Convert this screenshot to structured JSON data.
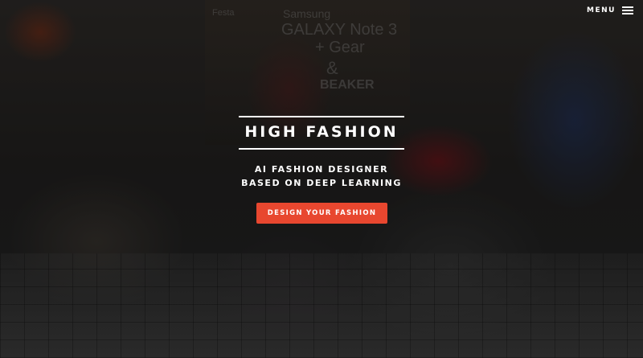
{
  "background": {
    "signs": {
      "festa": "Festa",
      "samsung": "Samsung",
      "galaxy": "GALAXY Note 3",
      "gear": "+ Gear",
      "amp": "&",
      "beaker": "BEAKER"
    }
  },
  "header": {
    "menu_label": "MENU",
    "menu_icon": "hamburger-icon"
  },
  "hero": {
    "title": "HIGH FASHION",
    "subtitle_line1": "AI FASHION DESIGNER",
    "subtitle_line2": "BASED ON DEEP LEARNING",
    "cta_label": "DESIGN YOUR FASHION"
  },
  "colors": {
    "accent": "#e8472f",
    "text": "#ffffff",
    "overlay": "rgba(0,0,0,0.45)"
  }
}
